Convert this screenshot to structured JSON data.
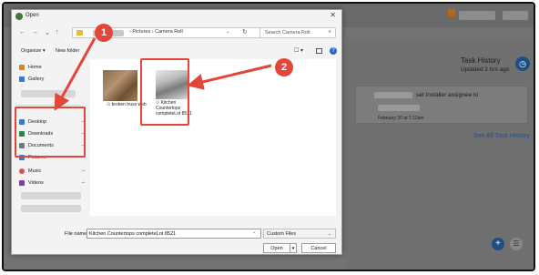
{
  "background": {
    "task_history_title": "Task History",
    "task_history_updated": "Updated 2 hrs ago",
    "history_entry_text": "set Installer assignee to",
    "history_entry_date": "February 20 at 7:12am",
    "see_all_link": "See All Task History",
    "fab_add": "+",
    "fab_list": "☰"
  },
  "dialog": {
    "title": "Open",
    "close_glyph": "✕",
    "nav": {
      "back": "←",
      "forward": "→",
      "dropdown": "⌄",
      "up": "↑"
    },
    "address": {
      "crumbs": "›  Pictures  ›  Camera Roll",
      "dropdown": "⌄",
      "refresh": "↻"
    },
    "search": {
      "placeholder": "Search Camera Roll",
      "icon": "⌕"
    },
    "toolbar": {
      "organize": "Organize ▾",
      "new_folder": "New folder",
      "view": "☐ ▾",
      "help": "?"
    },
    "sidebar": {
      "items": [
        {
          "label": "Home"
        },
        {
          "label": "Gallery"
        },
        {
          "label": "Desktop",
          "pin": "📌"
        },
        {
          "label": "Downloads",
          "pin": "📌"
        },
        {
          "label": "Documents",
          "pin": "📌"
        },
        {
          "label": "Pictures",
          "pin": "📌"
        },
        {
          "label": "Music",
          "pin": "📌"
        },
        {
          "label": "Videos",
          "pin": "📌"
        }
      ]
    },
    "files": [
      {
        "name": "broken truss web",
        "status": "⊙"
      },
      {
        "name": "Kitchen Countertops completeLot 8521",
        "status": "⊙"
      }
    ],
    "bottom": {
      "file_name_label": "File name:",
      "file_name_value": "Kitchen Countertops completeLot 8521",
      "file_type": "Custom Files",
      "open": "Open",
      "open_split": "▾",
      "cancel": "Cancel"
    }
  },
  "annotations": {
    "badge1": "1",
    "badge2": "2",
    "color": "#e4463a"
  }
}
